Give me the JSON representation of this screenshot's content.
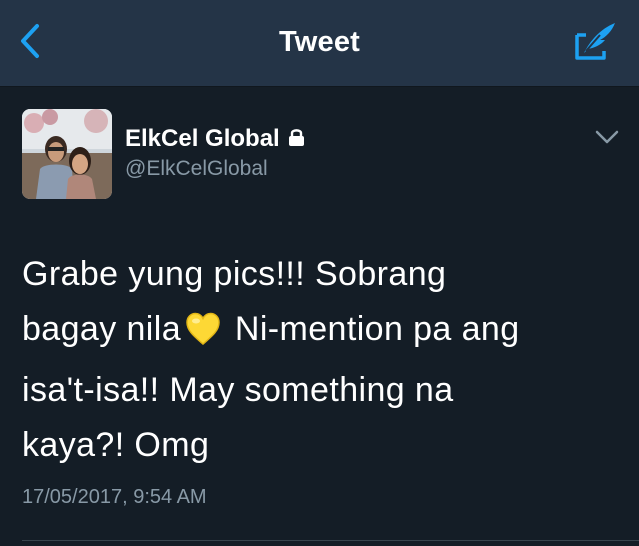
{
  "navbar": {
    "title": "Tweet",
    "back_icon": "chevron-left-icon",
    "compose_icon": "compose-feather-icon",
    "accent_color": "#1da1f2"
  },
  "tweet": {
    "display_name": "ElkCel Global",
    "protected_icon": "lock-icon",
    "handle": "@ElkCelGlobal",
    "menu_icon": "chevron-down-icon",
    "text_lines": [
      [
        "Grabe yung pics!!! Sobrang"
      ],
      [
        "bagay nila",
        "Ni-mention pa ang"
      ],
      [
        "isa't-isa!! May something na"
      ],
      [
        "kaya?! Omg"
      ]
    ],
    "emoji": "yellow-heart",
    "timestamp": "17/05/2017, 9:54 AM"
  },
  "colors": {
    "background": "#141d26",
    "navbar": "#243447",
    "secondary_text": "#8899a6",
    "divider": "#38444d"
  }
}
